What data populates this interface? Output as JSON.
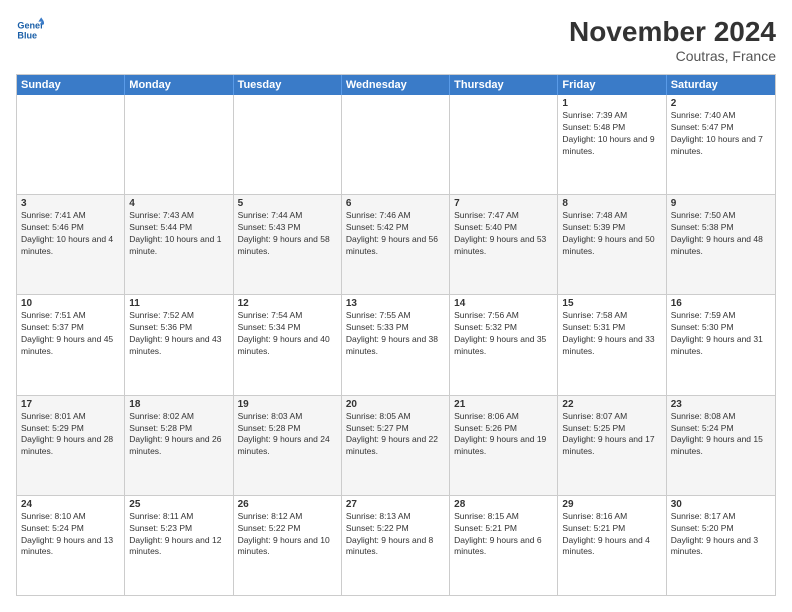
{
  "logo": {
    "line1": "General",
    "line2": "Blue"
  },
  "header": {
    "title": "November 2024",
    "location": "Coutras, France"
  },
  "weekdays": [
    "Sunday",
    "Monday",
    "Tuesday",
    "Wednesday",
    "Thursday",
    "Friday",
    "Saturday"
  ],
  "rows": [
    {
      "alt": false,
      "cells": [
        {
          "day": "",
          "info": ""
        },
        {
          "day": "",
          "info": ""
        },
        {
          "day": "",
          "info": ""
        },
        {
          "day": "",
          "info": ""
        },
        {
          "day": "",
          "info": ""
        },
        {
          "day": "1",
          "info": "Sunrise: 7:39 AM\nSunset: 5:48 PM\nDaylight: 10 hours and 9 minutes."
        },
        {
          "day": "2",
          "info": "Sunrise: 7:40 AM\nSunset: 5:47 PM\nDaylight: 10 hours and 7 minutes."
        }
      ]
    },
    {
      "alt": true,
      "cells": [
        {
          "day": "3",
          "info": "Sunrise: 7:41 AM\nSunset: 5:46 PM\nDaylight: 10 hours and 4 minutes."
        },
        {
          "day": "4",
          "info": "Sunrise: 7:43 AM\nSunset: 5:44 PM\nDaylight: 10 hours and 1 minute."
        },
        {
          "day": "5",
          "info": "Sunrise: 7:44 AM\nSunset: 5:43 PM\nDaylight: 9 hours and 58 minutes."
        },
        {
          "day": "6",
          "info": "Sunrise: 7:46 AM\nSunset: 5:42 PM\nDaylight: 9 hours and 56 minutes."
        },
        {
          "day": "7",
          "info": "Sunrise: 7:47 AM\nSunset: 5:40 PM\nDaylight: 9 hours and 53 minutes."
        },
        {
          "day": "8",
          "info": "Sunrise: 7:48 AM\nSunset: 5:39 PM\nDaylight: 9 hours and 50 minutes."
        },
        {
          "day": "9",
          "info": "Sunrise: 7:50 AM\nSunset: 5:38 PM\nDaylight: 9 hours and 48 minutes."
        }
      ]
    },
    {
      "alt": false,
      "cells": [
        {
          "day": "10",
          "info": "Sunrise: 7:51 AM\nSunset: 5:37 PM\nDaylight: 9 hours and 45 minutes."
        },
        {
          "day": "11",
          "info": "Sunrise: 7:52 AM\nSunset: 5:36 PM\nDaylight: 9 hours and 43 minutes."
        },
        {
          "day": "12",
          "info": "Sunrise: 7:54 AM\nSunset: 5:34 PM\nDaylight: 9 hours and 40 minutes."
        },
        {
          "day": "13",
          "info": "Sunrise: 7:55 AM\nSunset: 5:33 PM\nDaylight: 9 hours and 38 minutes."
        },
        {
          "day": "14",
          "info": "Sunrise: 7:56 AM\nSunset: 5:32 PM\nDaylight: 9 hours and 35 minutes."
        },
        {
          "day": "15",
          "info": "Sunrise: 7:58 AM\nSunset: 5:31 PM\nDaylight: 9 hours and 33 minutes."
        },
        {
          "day": "16",
          "info": "Sunrise: 7:59 AM\nSunset: 5:30 PM\nDaylight: 9 hours and 31 minutes."
        }
      ]
    },
    {
      "alt": true,
      "cells": [
        {
          "day": "17",
          "info": "Sunrise: 8:01 AM\nSunset: 5:29 PM\nDaylight: 9 hours and 28 minutes."
        },
        {
          "day": "18",
          "info": "Sunrise: 8:02 AM\nSunset: 5:28 PM\nDaylight: 9 hours and 26 minutes."
        },
        {
          "day": "19",
          "info": "Sunrise: 8:03 AM\nSunset: 5:28 PM\nDaylight: 9 hours and 24 minutes."
        },
        {
          "day": "20",
          "info": "Sunrise: 8:05 AM\nSunset: 5:27 PM\nDaylight: 9 hours and 22 minutes."
        },
        {
          "day": "21",
          "info": "Sunrise: 8:06 AM\nSunset: 5:26 PM\nDaylight: 9 hours and 19 minutes."
        },
        {
          "day": "22",
          "info": "Sunrise: 8:07 AM\nSunset: 5:25 PM\nDaylight: 9 hours and 17 minutes."
        },
        {
          "day": "23",
          "info": "Sunrise: 8:08 AM\nSunset: 5:24 PM\nDaylight: 9 hours and 15 minutes."
        }
      ]
    },
    {
      "alt": false,
      "cells": [
        {
          "day": "24",
          "info": "Sunrise: 8:10 AM\nSunset: 5:24 PM\nDaylight: 9 hours and 13 minutes."
        },
        {
          "day": "25",
          "info": "Sunrise: 8:11 AM\nSunset: 5:23 PM\nDaylight: 9 hours and 12 minutes."
        },
        {
          "day": "26",
          "info": "Sunrise: 8:12 AM\nSunset: 5:22 PM\nDaylight: 9 hours and 10 minutes."
        },
        {
          "day": "27",
          "info": "Sunrise: 8:13 AM\nSunset: 5:22 PM\nDaylight: 9 hours and 8 minutes."
        },
        {
          "day": "28",
          "info": "Sunrise: 8:15 AM\nSunset: 5:21 PM\nDaylight: 9 hours and 6 minutes."
        },
        {
          "day": "29",
          "info": "Sunrise: 8:16 AM\nSunset: 5:21 PM\nDaylight: 9 hours and 4 minutes."
        },
        {
          "day": "30",
          "info": "Sunrise: 8:17 AM\nSunset: 5:20 PM\nDaylight: 9 hours and 3 minutes."
        }
      ]
    }
  ]
}
